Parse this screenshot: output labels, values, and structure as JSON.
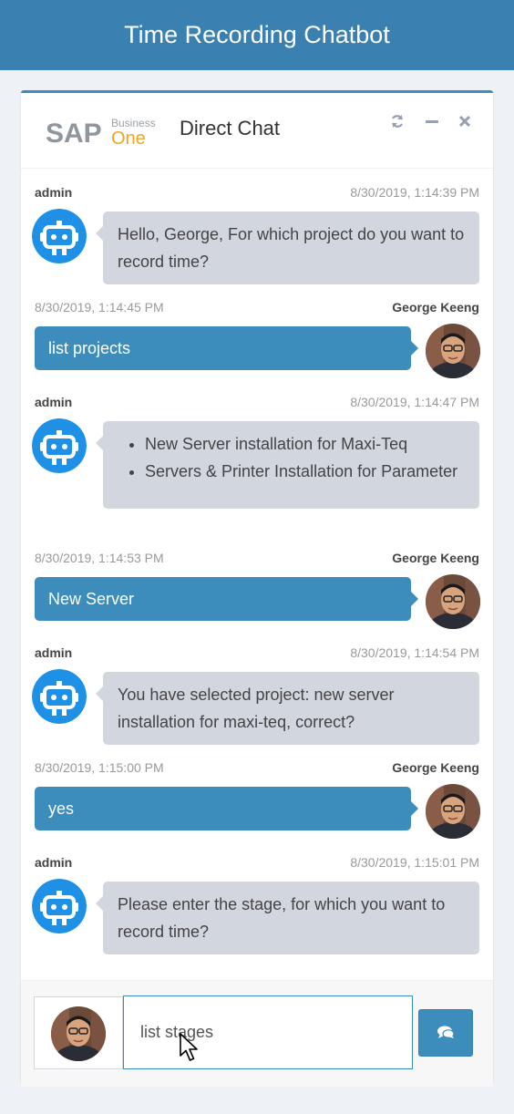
{
  "header": {
    "title": "Time Recording Chatbot"
  },
  "chat": {
    "logo": {
      "brand": "SAP",
      "line1": "Business",
      "line2": "One"
    },
    "title": "Direct Chat",
    "tools": {
      "refresh_icon": "refresh-icon",
      "minimize_icon": "minus-icon",
      "close_icon": "close-icon"
    },
    "colors": {
      "accent": "#3c8dbc",
      "header_bg": "#3a80b0",
      "bot_bubble": "#d2d6de",
      "bot_icon": "#1e90e6"
    },
    "messages": [
      {
        "side": "left",
        "name": "admin",
        "time": "8/30/2019, 1:14:39 PM",
        "text": "Hello, George, For which project do you want to record time?"
      },
      {
        "side": "right",
        "name": "George Keeng",
        "time": "8/30/2019, 1:14:45 PM",
        "text": "list projects"
      },
      {
        "side": "left",
        "name": "admin",
        "time": "8/30/2019, 1:14:47 PM",
        "items": [
          "New Server installation for Maxi-Teq",
          "Servers & Printer Installation for Parameter"
        ]
      },
      {
        "side": "right",
        "name": "George Keeng",
        "time": "8/30/2019, 1:14:53 PM",
        "text": "New Server"
      },
      {
        "side": "left",
        "name": "admin",
        "time": "8/30/2019, 1:14:54 PM",
        "text": "You have selected project: new server installation for maxi-teq, correct?"
      },
      {
        "side": "right",
        "name": "George Keeng",
        "time": "8/30/2019, 1:15:00 PM",
        "text": "yes"
      },
      {
        "side": "left",
        "name": "admin",
        "time": "8/30/2019, 1:15:01 PM",
        "text": "Please enter the stage, for which you want to record time?"
      }
    ],
    "input": {
      "value": "list stages"
    },
    "send_icon": "comments-icon"
  }
}
